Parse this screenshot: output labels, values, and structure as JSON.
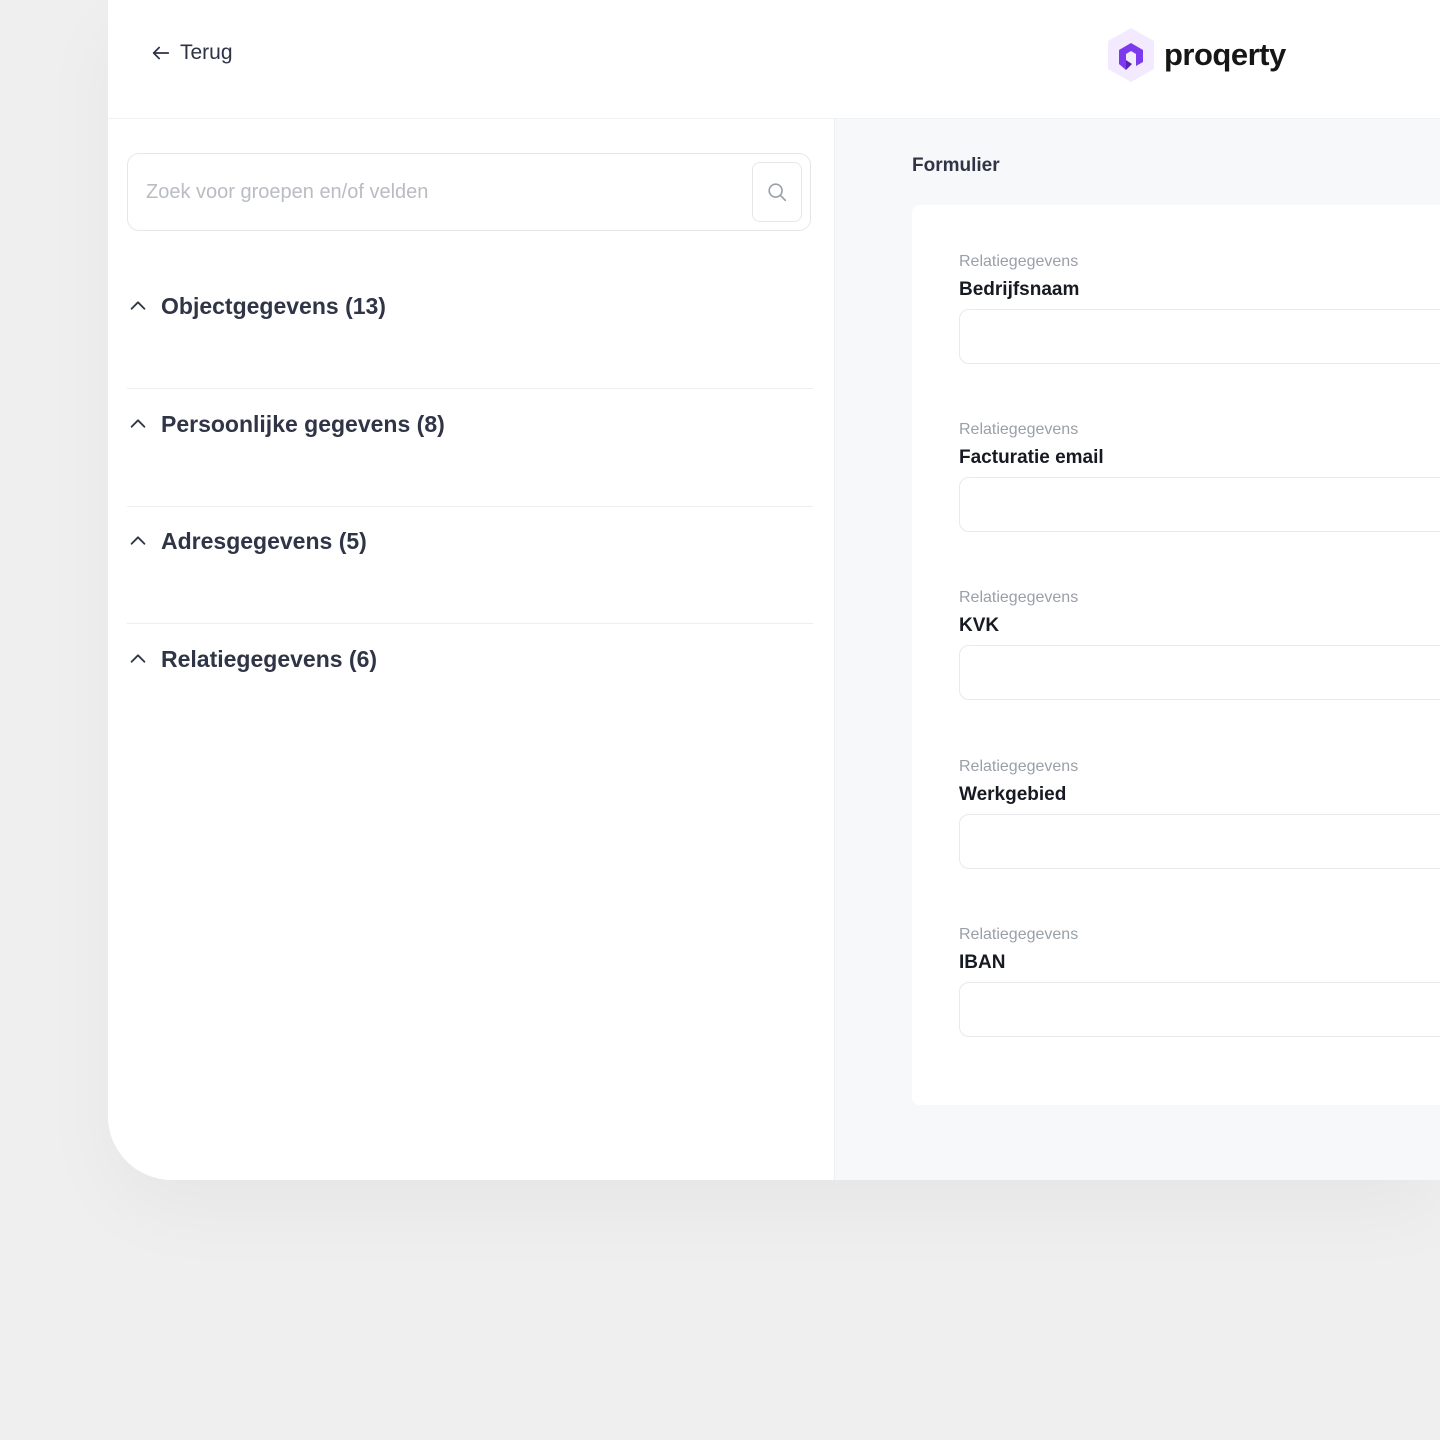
{
  "header": {
    "back_label": "Terug",
    "logo_text": "proqerty",
    "brand_color": "#7c3aed"
  },
  "search": {
    "placeholder": "Zoek voor groepen en/of velden",
    "value": ""
  },
  "groups": [
    {
      "label": "Objectgegevens (13)"
    },
    {
      "label": "Persoonlijke gegevens (8)"
    },
    {
      "label": "Adresgegevens (5)"
    },
    {
      "label": "Relatiegegevens (6)"
    }
  ],
  "form": {
    "heading": "Formulier",
    "fields": [
      {
        "group": "Relatiegegevens",
        "label": "Bedrijfsnaam",
        "value": ""
      },
      {
        "group": "Relatiegegevens",
        "label": "Facturatie email",
        "value": ""
      },
      {
        "group": "Relatiegegevens",
        "label": "KVK",
        "value": ""
      },
      {
        "group": "Relatiegegevens",
        "label": "Werkgebied",
        "value": ""
      },
      {
        "group": "Relatiegegevens",
        "label": "IBAN",
        "value": ""
      }
    ]
  }
}
